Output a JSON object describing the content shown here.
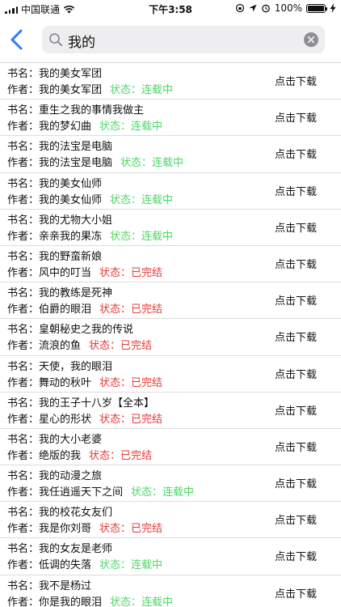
{
  "status_bar": {
    "carrier": "中国联通",
    "time": "下午3:58",
    "battery": "100%"
  },
  "search": {
    "query": "我的"
  },
  "labels": {
    "title_prefix": "书名：",
    "author_prefix": "作者："
  },
  "books": [
    {
      "title": "我的美女军团",
      "author": "我的美女军团",
      "status": "状态：连载中",
      "state": "ongoing",
      "action": "点击下载"
    },
    {
      "title": "重生之我的事情我做主",
      "author": "我的梦幻曲",
      "status": "状态：连载中",
      "state": "ongoing",
      "action": "点击下载"
    },
    {
      "title": "我的法宝是电脑",
      "author": "我的法宝是电脑",
      "status": "状态：连载中",
      "state": "ongoing",
      "action": "点击下载"
    },
    {
      "title": "我的美女仙师",
      "author": "我的美女仙师",
      "status": "状态：连载中",
      "state": "ongoing",
      "action": "点击下载"
    },
    {
      "title": "我的尤物大小姐",
      "author": "亲亲我的果冻",
      "status": "状态：连载中",
      "state": "ongoing",
      "action": "点击下载"
    },
    {
      "title": "我的野蛮新娘",
      "author": "风中的叮当",
      "status": "状态：已完结",
      "state": "done",
      "action": "点击下载"
    },
    {
      "title": "我的教练是死神",
      "author": "伯爵的眼泪",
      "status": "状态：已完结",
      "state": "done",
      "action": "点击下载"
    },
    {
      "title": "皇朝秘史之我的传说",
      "author": "流浪的鱼",
      "status": "状态：已完结",
      "state": "done",
      "action": "点击下载"
    },
    {
      "title": "天使，我的眼泪",
      "author": "舞动的秋叶",
      "status": "状态：已完结",
      "state": "done",
      "action": "点击下载"
    },
    {
      "title": "我的王子十八岁【全本】",
      "author": "星心的形状",
      "status": "状态：已完结",
      "state": "done",
      "action": "点击下载"
    },
    {
      "title": "我的大小老婆",
      "author": "绝版的我",
      "status": "状态：已完结",
      "state": "done",
      "action": "点击下载"
    },
    {
      "title": "我的动漫之旅",
      "author": "我任逍遥天下之间",
      "status": "状态：连载中",
      "state": "ongoing",
      "action": "点击下载"
    },
    {
      "title": "我的校花女友们",
      "author": "我是你刘哥",
      "status": "状态：已完结",
      "state": "done",
      "action": "点击下载"
    },
    {
      "title": "我的女友是老师",
      "author": "低调的失落",
      "status": "状态：连载中",
      "state": "ongoing",
      "action": "点击下载"
    },
    {
      "title": "我不是杨过",
      "author": "你是我的眼泪",
      "status": "状态：连载中",
      "state": "ongoing",
      "action": "点击下载"
    }
  ]
}
